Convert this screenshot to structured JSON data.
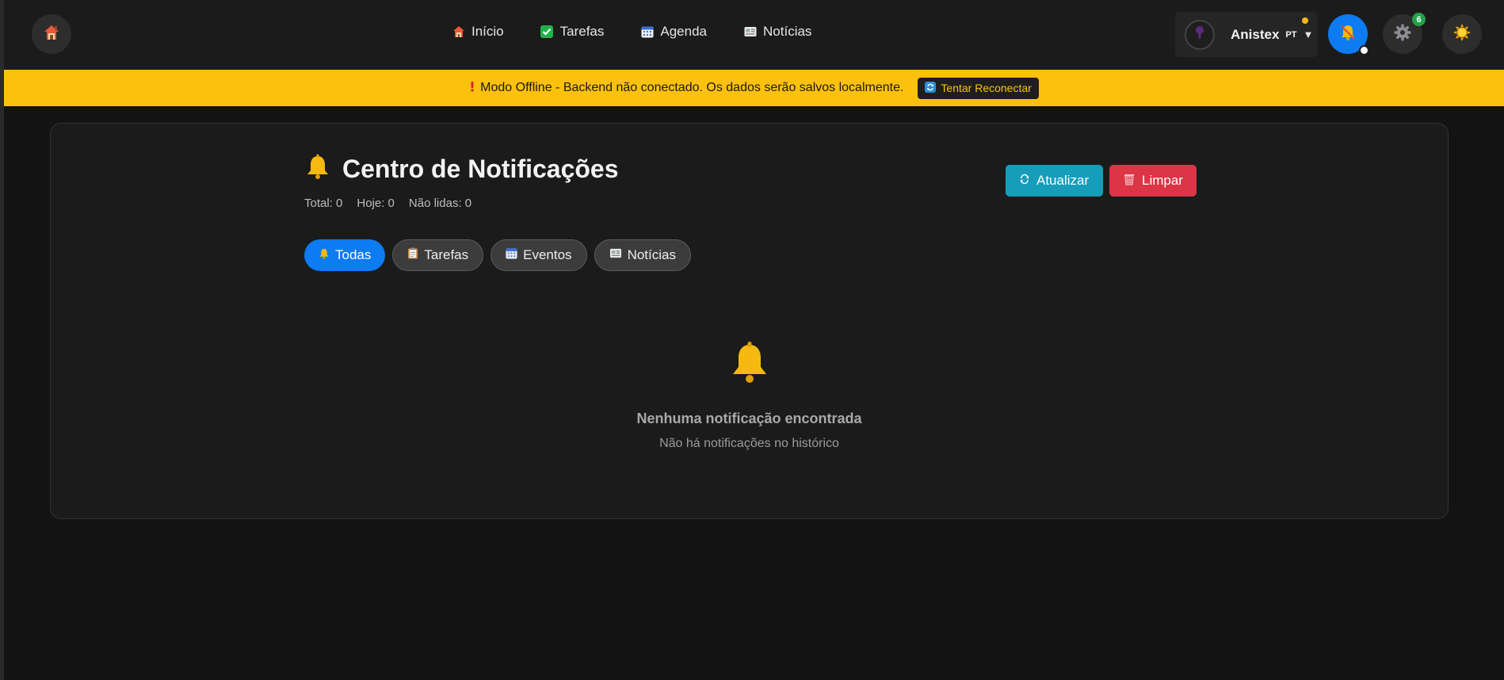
{
  "nav": {
    "items": [
      {
        "label": "Início",
        "icon": "house-icon"
      },
      {
        "label": "Tarefas",
        "icon": "check-box-icon"
      },
      {
        "label": "Agenda",
        "icon": "calendar-icon"
      },
      {
        "label": "Notícias",
        "icon": "newspaper-icon"
      }
    ]
  },
  "user": {
    "name": "Anistex",
    "language": "PT",
    "avatar_icon": "user-silhouette-icon"
  },
  "settings": {
    "badge_count": "6"
  },
  "banner": {
    "icon": "exclamation-icon",
    "text": "Modo Offline - Backend não conectado. Os dados serão salvos localmente.",
    "button_label": "Tentar Reconectar",
    "color": "#fcc10d"
  },
  "notifications": {
    "title": "Centro de Notificações",
    "stats": {
      "total": "Total: 0",
      "today": "Hoje: 0",
      "unread": "Não lidas: 0"
    },
    "refresh_label": "Atualizar",
    "clear_label": "Limpar",
    "tabs": [
      {
        "label": "Todas",
        "active": true
      },
      {
        "label": "Tarefas",
        "active": false
      },
      {
        "label": "Eventos",
        "active": false
      },
      {
        "label": "Notícias",
        "active": false
      }
    ],
    "empty": {
      "title": "Nenhuma notificação encontrada",
      "subtitle": "Não há notificações no histórico"
    }
  },
  "colors": {
    "accent_blue": "#0d7bf2",
    "teal": "#169db9",
    "red": "#dc3545",
    "yellow": "#fcc10d",
    "bell_gold": "#f6b910"
  }
}
